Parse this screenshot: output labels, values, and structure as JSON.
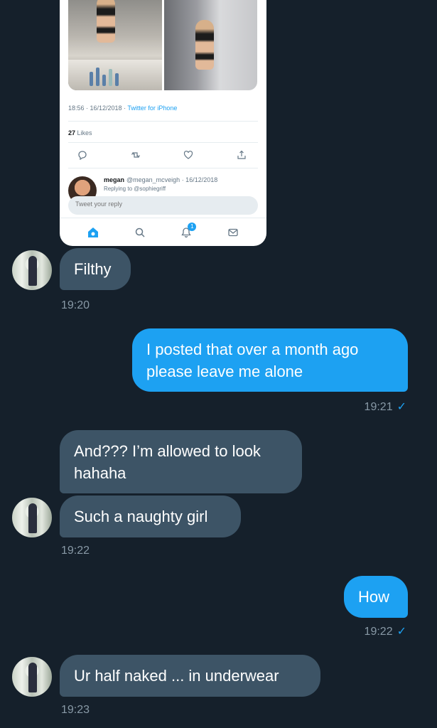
{
  "tweet_card": {
    "timestamp": "18:56 · 16/12/2018 · ",
    "via": "Twitter for iPhone",
    "likes_count": "27",
    "likes_label": "Likes",
    "reply": {
      "name": "megan",
      "handle": "@megan_mcveigh · 16/12/2018",
      "replying_to": "Replying to @sophiegriff"
    },
    "compose_placeholder": "Tweet your reply",
    "tabs": [
      {
        "icon": "home-icon"
      },
      {
        "icon": "search-icon"
      },
      {
        "icon": "notifications-icon",
        "badge": "1"
      },
      {
        "icon": "messages-icon"
      }
    ]
  },
  "messages": [
    {
      "direction": "incoming",
      "text": "Filthy",
      "time": "19:20"
    },
    {
      "direction": "outgoing",
      "text": "I posted that over a month ago please leave me alone",
      "time": "19:21"
    },
    {
      "direction": "incoming",
      "text": "And??? I’m allowed to look hahaha",
      "time": ""
    },
    {
      "direction": "incoming",
      "text": "Such a naughty girl",
      "time": "19:22"
    },
    {
      "direction": "outgoing",
      "text": "How",
      "time": "19:22"
    },
    {
      "direction": "incoming",
      "text": "Ur half naked ... in underwear",
      "time": "19:23"
    }
  ],
  "colors": {
    "background": "#15202b",
    "incoming_bubble": "#3d5466",
    "outgoing_bubble": "#1da1f2",
    "timestamp": "#8899a6"
  }
}
